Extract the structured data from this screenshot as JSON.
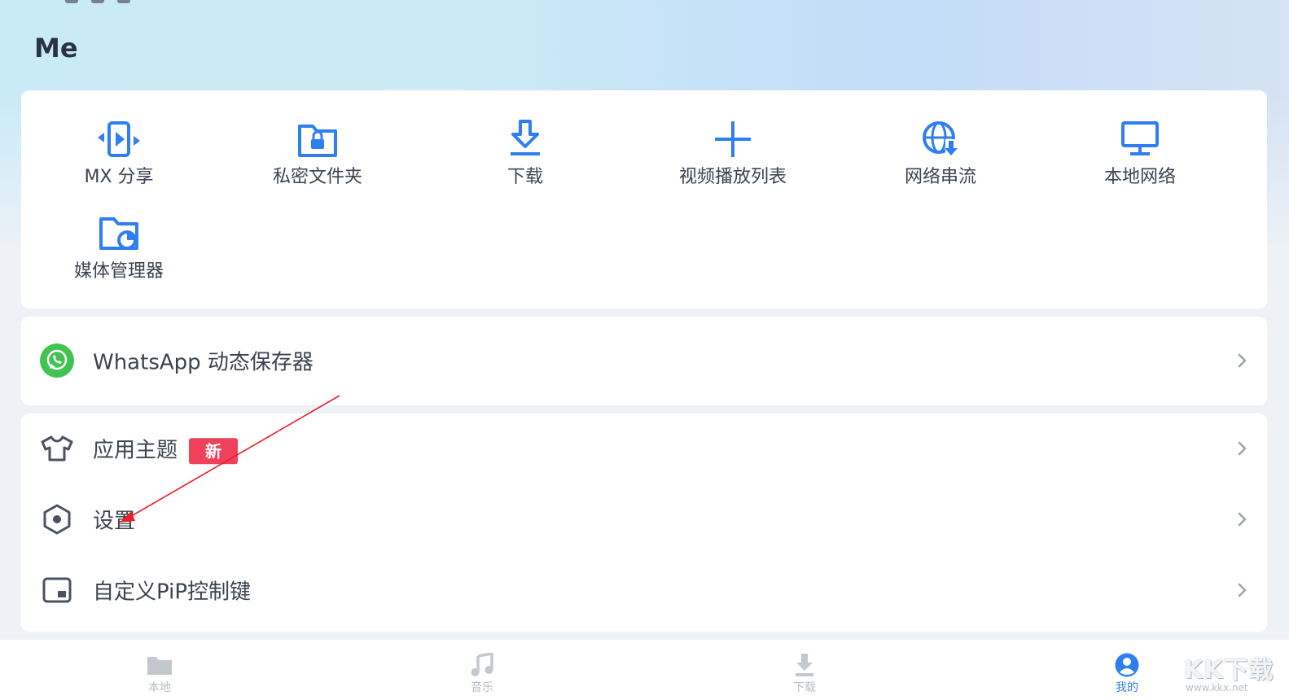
{
  "page": {
    "title": "Me"
  },
  "colors": {
    "accent": "#2f7ff0",
    "badge": "#f0405a",
    "whatsapp": "#40c351",
    "annotation_arrow": "#e8202a"
  },
  "quick_actions": [
    {
      "label": "MX 分享",
      "icon": "mx-share-icon"
    },
    {
      "label": "私密文件夹",
      "icon": "private-folder-icon"
    },
    {
      "label": "下载",
      "icon": "download-icon"
    },
    {
      "label": "视频播放列表",
      "icon": "plus-icon"
    },
    {
      "label": "网络串流",
      "icon": "network-stream-icon"
    },
    {
      "label": "本地网络",
      "icon": "monitor-icon"
    },
    {
      "label": "媒体管理器",
      "icon": "media-manager-icon"
    }
  ],
  "whatsapp": {
    "label": "WhatsApp 动态保存器",
    "icon": "whatsapp-icon"
  },
  "list": [
    {
      "label": "应用主题",
      "icon": "shirt-icon",
      "badge": "新"
    },
    {
      "label": "设置",
      "icon": "settings-icon"
    },
    {
      "label": "自定义PiP控制键",
      "icon": "pip-icon"
    }
  ],
  "nav": [
    {
      "label": "本地",
      "icon": "folder-icon",
      "active": false
    },
    {
      "label": "音乐",
      "icon": "music-icon",
      "active": false
    },
    {
      "label": "下载",
      "icon": "download-icon",
      "active": false
    },
    {
      "label": "我的",
      "icon": "profile-icon",
      "active": true
    }
  ],
  "watermark": {
    "text": "KK下载",
    "url": "www.kkx.net"
  }
}
